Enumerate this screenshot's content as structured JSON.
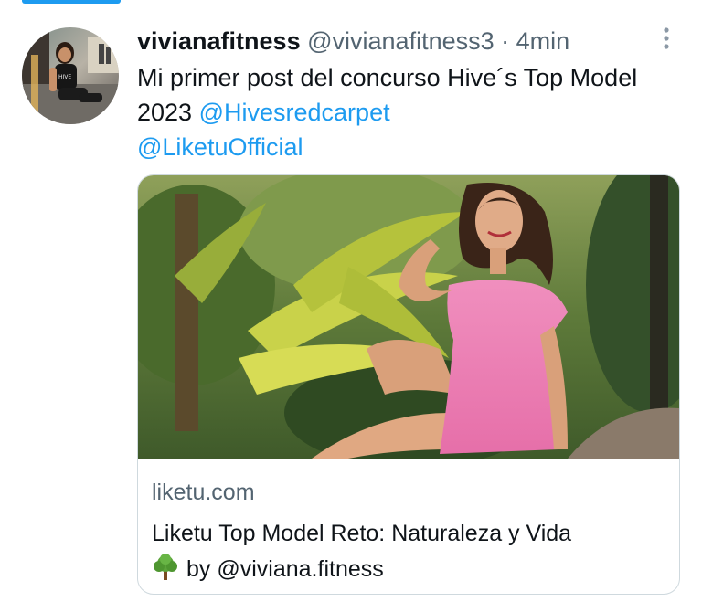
{
  "tweet": {
    "display_name": "vivianafitness",
    "handle": "@vivianafitness3",
    "separator": "·",
    "time": "4min",
    "text": "Mi primer post del concurso Hive´s Top Model 2023",
    "mentions": [
      "@Hivesredcarpet",
      "@LiketuOfficial"
    ]
  },
  "card": {
    "domain": "liketu.com",
    "title_line1": "Liketu Top Model Reto: Naturaleza y Vida",
    "title_line2": "by @viviana.fitness",
    "emoji_icon": "deciduous-tree-icon"
  },
  "colors": {
    "accent": "#1d9bf0",
    "text": "#0f1419",
    "secondary": "#536471",
    "border": "#cfd9de"
  }
}
